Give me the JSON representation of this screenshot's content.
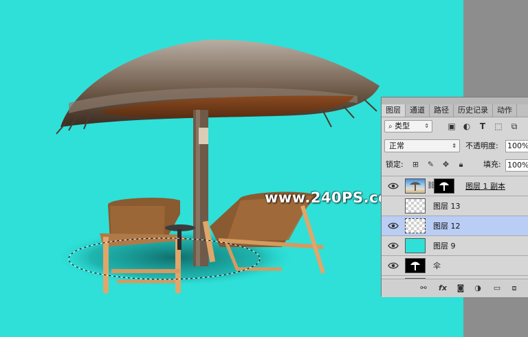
{
  "watermark": "www.240PS.com",
  "colors": {
    "canvas_bg": "#2ee0d8",
    "workspace_bg": "#8d8d8d",
    "selected_layer_bg": "#b9cdf5"
  },
  "panel": {
    "tabs": [
      {
        "label": "图层",
        "active": true
      },
      {
        "label": "通道",
        "active": false
      },
      {
        "label": "路径",
        "active": false
      },
      {
        "label": "历史记录",
        "active": false
      },
      {
        "label": "动作",
        "active": false
      }
    ],
    "filter": {
      "kind_label": "类型",
      "icons": [
        "image-filter-icon",
        "adjustment-filter-icon",
        "type-filter-icon",
        "shape-filter-icon",
        "smart-object-filter-icon"
      ]
    },
    "blend": {
      "mode": "正常",
      "opacity_label": "不透明度:",
      "opacity_value": "100%"
    },
    "lock": {
      "label": "锁定:",
      "fill_label": "填充:",
      "fill_value": "100%"
    },
    "layers": [
      {
        "name": "图层 1 副本",
        "visible": true,
        "thumb": "photo",
        "has_mask": true,
        "selected": false
      },
      {
        "name": "图层 13",
        "visible": false,
        "thumb": "transparent",
        "has_mask": false,
        "selected": false
      },
      {
        "name": "图层 12",
        "visible": true,
        "thumb": "transparent",
        "has_mask": false,
        "selected": true
      },
      {
        "name": "图层 9",
        "visible": true,
        "thumb": "cyan",
        "has_mask": false,
        "selected": false
      },
      {
        "name": "伞",
        "visible": true,
        "thumb": "umbrella-mask",
        "has_mask": false,
        "selected": false
      }
    ],
    "footer_icons": [
      "link-icon",
      "fx-icon",
      "add-mask-icon",
      "adjustment-icon",
      "folder-icon",
      "new-layer-icon"
    ]
  }
}
